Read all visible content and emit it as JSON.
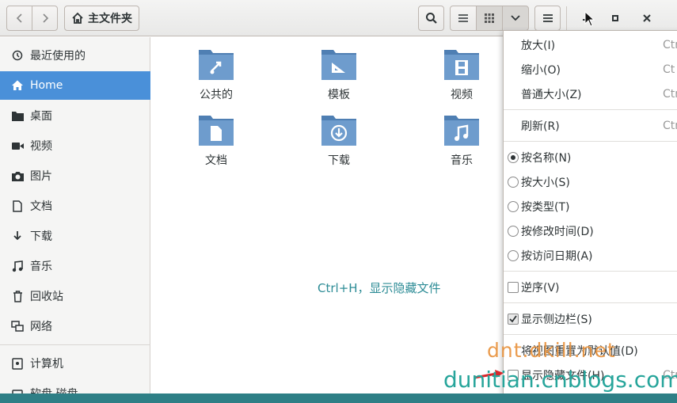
{
  "header": {
    "location": "主文件夹"
  },
  "sidebar": {
    "items": [
      {
        "label": "最近使用的",
        "icon": "clock-icon"
      },
      {
        "label": "Home",
        "icon": "home-icon",
        "active": true
      },
      {
        "label": "桌面",
        "icon": "folder-icon"
      },
      {
        "label": "视频",
        "icon": "video-icon"
      },
      {
        "label": "图片",
        "icon": "camera-icon"
      },
      {
        "label": "文档",
        "icon": "document-icon"
      },
      {
        "label": "下载",
        "icon": "download-icon"
      },
      {
        "label": "音乐",
        "icon": "music-icon"
      },
      {
        "label": "回收站",
        "icon": "trash-icon"
      },
      {
        "label": "网络",
        "icon": "network-icon"
      },
      {
        "label": "计算机",
        "icon": "computer-icon"
      },
      {
        "label": "软盘 磁盘",
        "icon": "disk-icon"
      }
    ]
  },
  "folders": [
    {
      "label": "公共的",
      "icon": "share-icon"
    },
    {
      "label": "模板",
      "icon": "template-icon"
    },
    {
      "label": "视频",
      "icon": "film-icon"
    },
    {
      "label": "文档",
      "icon": "document-icon"
    },
    {
      "label": "下载",
      "icon": "download-icon"
    },
    {
      "label": "音乐",
      "icon": "music-note-icon"
    }
  ],
  "content": {
    "hint": "Ctrl+H，显示隐藏文件"
  },
  "menu": {
    "zoom_in": {
      "label": "放大(I)",
      "accel": "Ctr"
    },
    "zoom_out": {
      "label": "缩小(O)",
      "accel": "Ct"
    },
    "normal_size": {
      "label": "普通大小(Z)",
      "accel": "Ctr"
    },
    "reload": {
      "label": "刷新(R)",
      "accel": "Ctr"
    },
    "sort_name": {
      "label": "按名称(N)",
      "selected": true
    },
    "sort_size": {
      "label": "按大小(S)",
      "selected": false
    },
    "sort_type": {
      "label": "按类型(T)",
      "selected": false
    },
    "sort_mtime": {
      "label": "按修改时间(D)",
      "selected": false
    },
    "sort_atime": {
      "label": "按访问日期(A)",
      "selected": false
    },
    "reverse": {
      "label": "逆序(V)",
      "checked": false
    },
    "show_sidebar": {
      "label": "显示侧边栏(S)",
      "checked": true
    },
    "reset_view": {
      "label": "将视图重置为默认值(D)"
    },
    "show_hidden": {
      "label": "显示隐藏文件(H)",
      "accel": "Ctr",
      "checked": false
    }
  },
  "watermarks": {
    "site1": "dnt.dkill.net",
    "site2": "dunitian.cnblogs.com"
  },
  "colors": {
    "accent": "#4a90d9",
    "folder": "#5f8fc4",
    "hint": "#2d8c96",
    "desktop": "#2e7f86"
  }
}
